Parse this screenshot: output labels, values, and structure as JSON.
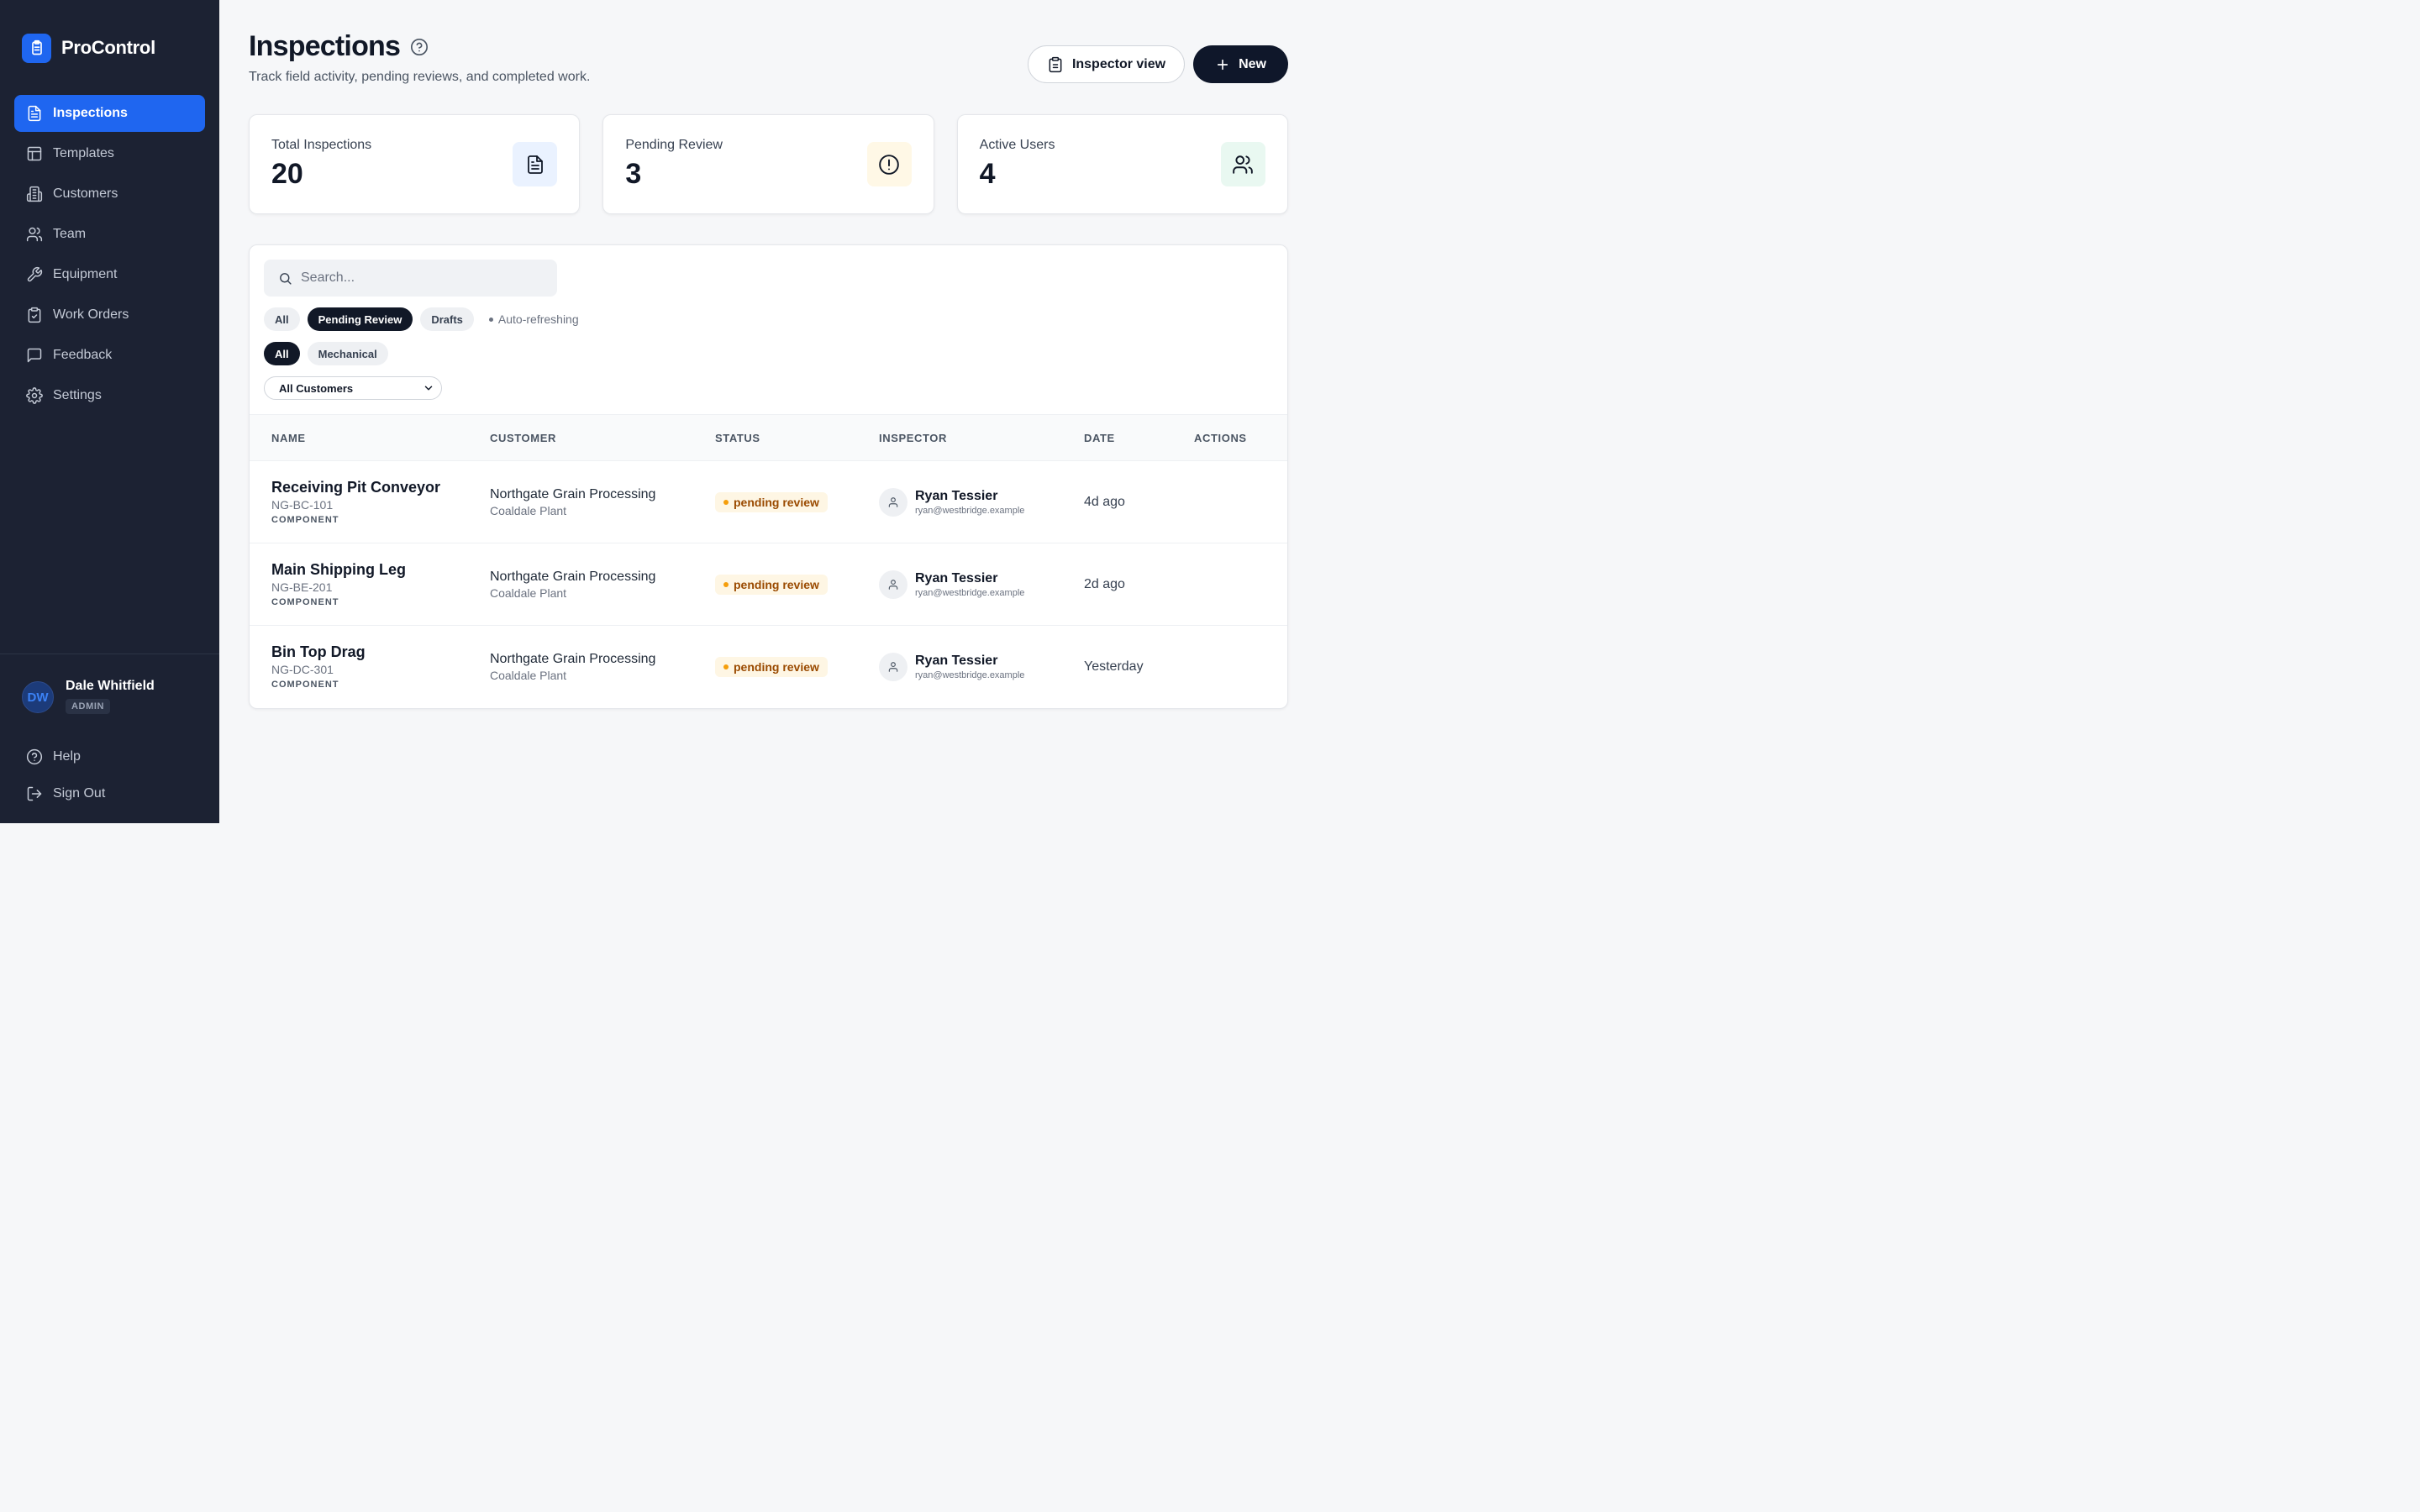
{
  "app": {
    "name": "ProControl"
  },
  "sidebar": {
    "items": [
      {
        "label": "Inspections",
        "icon": "file-text-icon",
        "active": true
      },
      {
        "label": "Templates",
        "icon": "layout-icon"
      },
      {
        "label": "Customers",
        "icon": "building-icon"
      },
      {
        "label": "Team",
        "icon": "users-icon"
      },
      {
        "label": "Equipment",
        "icon": "wrench-icon"
      },
      {
        "label": "Work Orders",
        "icon": "clipboard-check-icon"
      },
      {
        "label": "Feedback",
        "icon": "message-square-icon"
      },
      {
        "label": "Settings",
        "icon": "gear-icon"
      }
    ],
    "user": {
      "initials": "DW",
      "name": "Dale Whitfield",
      "role": "ADMIN"
    },
    "bottom": [
      {
        "label": "Help",
        "icon": "help-circle-icon"
      },
      {
        "label": "Sign Out",
        "icon": "log-out-icon"
      }
    ]
  },
  "header": {
    "title": "Inspections",
    "subtitle": "Track field activity, pending reviews, and completed work.",
    "inspector_view_label": "Inspector view",
    "new_label": "New"
  },
  "stats": [
    {
      "label": "Total Inspections",
      "value": "20",
      "icon": "document-icon",
      "bg": "#eaf2ff"
    },
    {
      "label": "Pending Review",
      "value": "3",
      "icon": "alert-circle-icon",
      "bg": "#fff8e6"
    },
    {
      "label": "Active Users",
      "value": "4",
      "icon": "users-icon",
      "bg": "#e9f8f1"
    }
  ],
  "filters": {
    "search_placeholder": "Search...",
    "status_chips": [
      {
        "label": "All",
        "active": false
      },
      {
        "label": "Pending Review",
        "active": true
      },
      {
        "label": "Drafts",
        "active": false
      }
    ],
    "auto_refresh": "Auto-refreshing",
    "type_chips": [
      {
        "label": "All",
        "active": true
      },
      {
        "label": "Mechanical",
        "active": false
      }
    ],
    "customer_select": "All Customers"
  },
  "table": {
    "headers": [
      "NAME",
      "CUSTOMER",
      "STATUS",
      "INSPECTOR",
      "DATE",
      "ACTIONS"
    ],
    "rows": [
      {
        "name": "Receiving Pit Conveyor",
        "code": "NG-BC-101",
        "kind": "COMPONENT",
        "customer": "Northgate Grain Processing",
        "site": "Coaldale Plant",
        "status": "pending review",
        "inspector": "Ryan Tessier",
        "email": "ryan@westbridge.example",
        "date": "4d ago"
      },
      {
        "name": "Main Shipping Leg",
        "code": "NG-BE-201",
        "kind": "COMPONENT",
        "customer": "Northgate Grain Processing",
        "site": "Coaldale Plant",
        "status": "pending review",
        "inspector": "Ryan Tessier",
        "email": "ryan@westbridge.example",
        "date": "2d ago"
      },
      {
        "name": "Bin Top Drag",
        "code": "NG-DC-301",
        "kind": "COMPONENT",
        "customer": "Northgate Grain Processing",
        "site": "Coaldale Plant",
        "status": "pending review",
        "inspector": "Ryan Tessier",
        "email": "ryan@westbridge.example",
        "date": "Yesterday"
      }
    ]
  },
  "colors": {
    "accent": "#1f66f0",
    "sidebar": "#1c2233",
    "dark_button": "#0f172a",
    "pending": "#f59e0b"
  }
}
